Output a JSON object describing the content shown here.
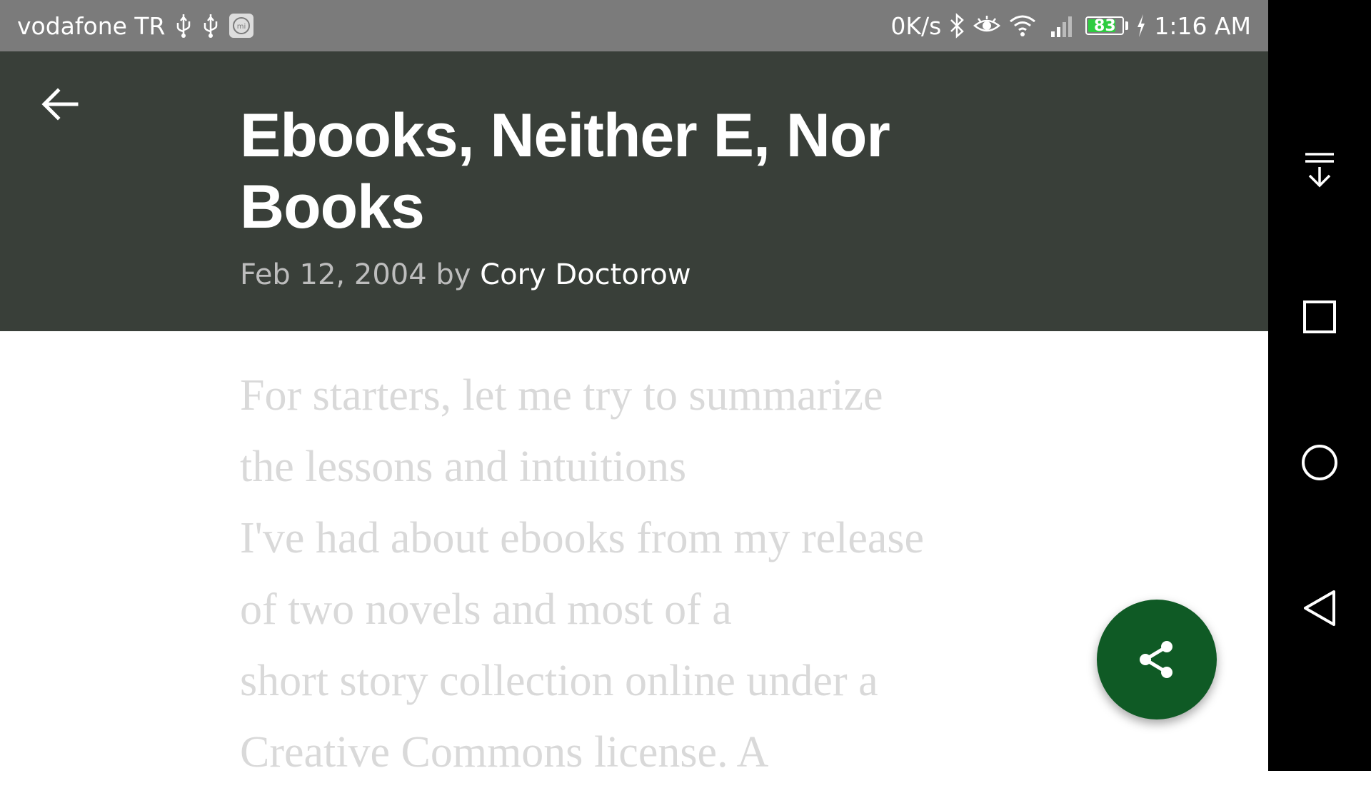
{
  "status_bar": {
    "carrier": "vodafone TR",
    "net_speed": "0K/s",
    "battery_level": "83",
    "battery_fraction": 0.83,
    "time": "1:16 AM",
    "icons": [
      "usb-icon",
      "usb-icon",
      "mi-icon",
      "bluetooth-icon",
      "eye-icon",
      "wifi-icon",
      "signal-icon",
      "battery-icon",
      "charging-icon"
    ]
  },
  "header": {
    "background": "#393f39",
    "title_line1": "Ebooks, Neither E, Nor",
    "title_line2": "Books",
    "date": "Feb 12, 2004",
    "by": "by",
    "author": "Cory Doctorow"
  },
  "article": {
    "lines": [
      "For starters, let me try to summarize",
      "the lessons and intuitions",
      "I've had about ebooks from my release",
      "of two novels and most of a",
      "short story collection online under a",
      "Creative Commons license. A"
    ]
  },
  "fab": {
    "icon": "share-icon",
    "color": "#0f5a25"
  },
  "nav_bar": {
    "buttons": [
      "notification-pull-icon",
      "recents-icon",
      "home-icon",
      "back-icon"
    ]
  }
}
